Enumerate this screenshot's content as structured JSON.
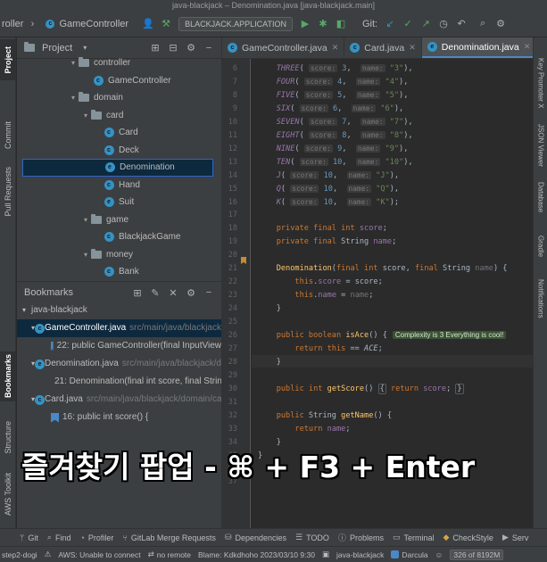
{
  "window_title": "java-blackjack – Denomination.java [java-blackjack.main]",
  "toolbar": {
    "project_name": "roller",
    "breadcrumb_file": "GameController",
    "run_config": "BLACKJACK.APPLICATION",
    "git_label": "Git:"
  },
  "left_stripe": {
    "project": "Project",
    "commit": "Commit",
    "pull_requests": "Pull Requests",
    "bookmarks": "Bookmarks",
    "structure": "Structure",
    "aws_toolkit": "AWS Toolkit"
  },
  "right_stripe": {
    "key_promoter": "Key Promoter X",
    "json_viewer": "JSON Viewer",
    "database": "Database",
    "gradle": "Gradle",
    "notifications": "Notifications"
  },
  "project_panel": {
    "title": "Project",
    "tree": [
      {
        "label": "controller",
        "kind": "folder"
      },
      {
        "label": "GameController",
        "kind": "class"
      },
      {
        "label": "domain",
        "kind": "folder"
      },
      {
        "label": "card",
        "kind": "folder"
      },
      {
        "label": "Card",
        "kind": "class"
      },
      {
        "label": "Deck",
        "kind": "class"
      },
      {
        "label": "Denomination",
        "kind": "enum"
      },
      {
        "label": "Hand",
        "kind": "class"
      },
      {
        "label": "Suit",
        "kind": "enum"
      },
      {
        "label": "game",
        "kind": "folder"
      },
      {
        "label": "BlackjackGame",
        "kind": "class"
      },
      {
        "label": "money",
        "kind": "folder"
      },
      {
        "label": "Bank",
        "kind": "class"
      }
    ]
  },
  "bookmarks_panel": {
    "title": "Bookmarks",
    "root": "java-blackjack",
    "files": [
      {
        "name": "GameController.java",
        "path": "src/main/java/blackjack/controller",
        "line": "22: public GameController(final InputView"
      },
      {
        "name": "Denomination.java",
        "path": "src/main/java/blackjack/domain/card",
        "line": "21: Denomination(final int score, final String"
      },
      {
        "name": "Card.java",
        "path": "src/main/java/blackjack/domain/card",
        "line": "16: public int score() {"
      }
    ]
  },
  "editor": {
    "tabs": [
      {
        "label": "GameController.java",
        "active": false
      },
      {
        "label": "Card.java",
        "active": false
      },
      {
        "label": "Denomination.java",
        "active": true
      }
    ],
    "line_numbers": [
      "6",
      "7",
      "8",
      "9",
      "10",
      "11",
      "12",
      "13",
      "14",
      "15",
      "16",
      "17",
      "18",
      "19",
      "20",
      "21",
      "22",
      "23",
      "24",
      "25",
      "26",
      "27",
      "28",
      "29",
      "30",
      "31",
      "32",
      "33",
      "34",
      "35",
      "36",
      "37"
    ],
    "complexity_hint": "Complexity is 3 Everything is cool!"
  },
  "caption": "즐겨찾기 팝업 - ⌘ + F3 + Enter",
  "bottom_tools": [
    "Git",
    "Find",
    "Profiler",
    "GitLab Merge Requests",
    "Dependencies",
    "TODO",
    "Problems",
    "Terminal",
    "CheckStyle",
    "Serv"
  ],
  "statusbar": {
    "left": "step2-dogi",
    "aws": "AWS: Unable to connect",
    "remote": "no remote",
    "blame": "Blame: Kdkdhoho 2023/03/10 9:30",
    "branch": "java-blackjack",
    "theme": "Darcula",
    "memory": "326 of 8192M"
  }
}
